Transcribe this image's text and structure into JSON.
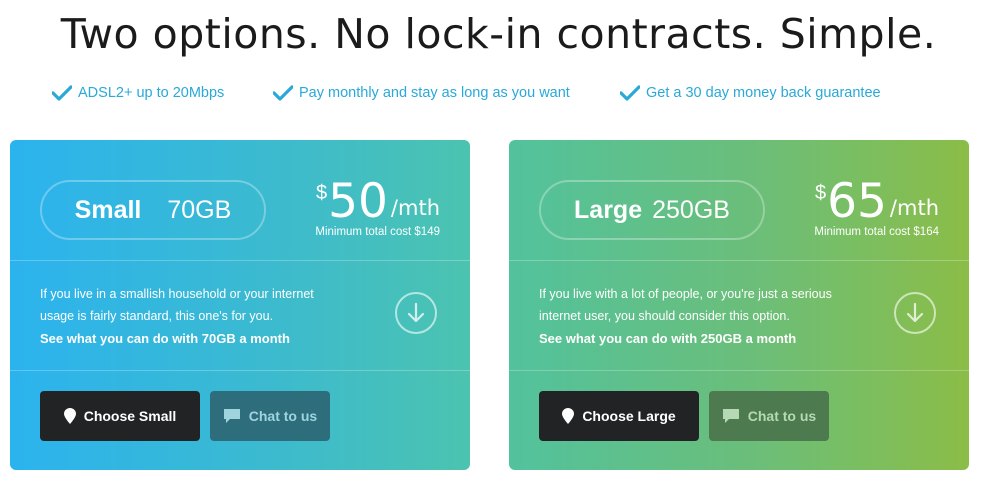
{
  "headline": "Two options. No lock-in contracts. Simple.",
  "features": [
    {
      "icon": "check-icon",
      "text": "ADSL2+ up to 20Mbps"
    },
    {
      "icon": "check-icon",
      "text": "Pay monthly and stay as long as you want"
    },
    {
      "icon": "check-icon",
      "text": "Get a 30 day money back guarantee"
    }
  ],
  "plans": [
    {
      "name": "Small",
      "data": "70GB",
      "currency": "$",
      "price": "50",
      "period": "/mth",
      "min_cost": "Minimum total cost $149",
      "desc_line1": "If you live in a smallish household or your internet",
      "desc_line2": "usage is fairly standard, this one's for you.",
      "desc_more": "See what you can do with 70GB a month",
      "choose_label": "Choose Small",
      "chat_label": "Chat to us"
    },
    {
      "name": "Large",
      "data": "250GB",
      "currency": "$",
      "price": "65",
      "period": "/mth",
      "min_cost": "Minimum total cost $164",
      "desc_line1": "If you live with a lot of people, or you're just a serious",
      "desc_line2": "internet user, you should consider this option.",
      "desc_more": "See what you can do with 250GB a month",
      "choose_label": "Choose Large",
      "chat_label": "Chat to us"
    }
  ],
  "colors": {
    "check": "#29a9d8",
    "small_card_start": "#2bb3ee",
    "small_card_end": "#4cc3b0",
    "large_card_start": "#52c29d",
    "large_card_end": "#8bbd47",
    "choose_button": "#222324"
  }
}
